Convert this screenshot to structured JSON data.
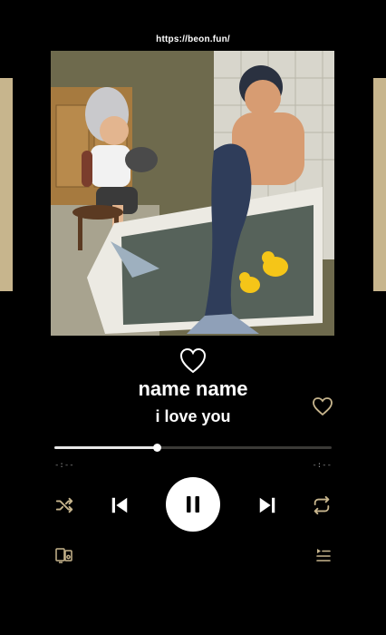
{
  "header": {
    "url": "https://beon.fun/"
  },
  "track": {
    "title": "name name",
    "artist": "i love you"
  },
  "progress": {
    "fraction": 0.37,
    "elapsed": "-:--",
    "remaining": "-:--"
  },
  "colors": {
    "accent": "#c7b58d",
    "background": "#000000",
    "progress_fill": "#e8e8e8"
  },
  "icons": {
    "center": "heart-outline-icon",
    "favorite": "heart-outline-icon",
    "shuffle": "shuffle-icon",
    "previous": "skip-previous-icon",
    "play_pause": "pause-icon",
    "next": "skip-next-icon",
    "repeat": "repeat-icon",
    "devices": "devices-icon",
    "queue": "queue-icon"
  }
}
